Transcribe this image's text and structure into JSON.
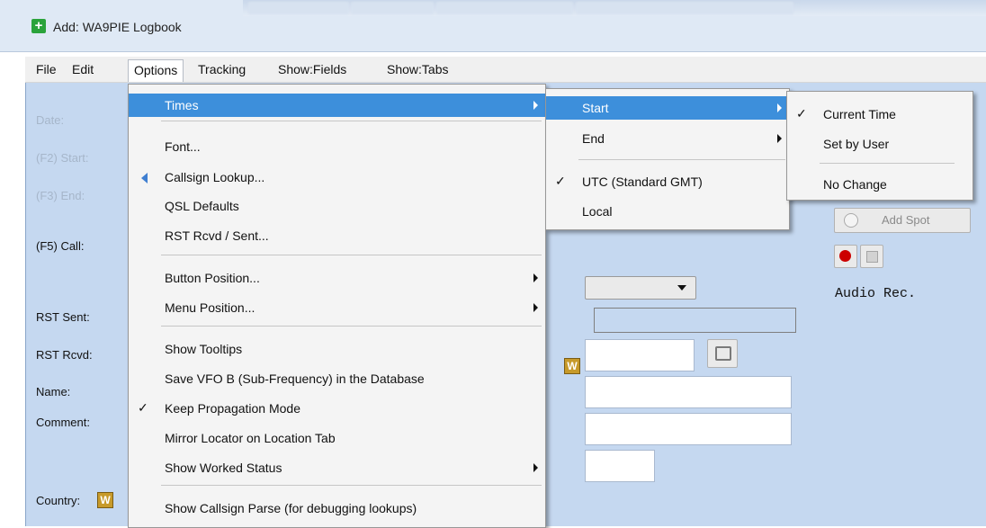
{
  "window": {
    "title": "Add: WA9PIE Logbook"
  },
  "menubar": [
    "File",
    "Edit",
    "Options",
    "Tracking",
    "Show:Fields",
    "Show:Tabs"
  ],
  "form": {
    "date_label": "Date:",
    "start_label": "(F2) Start:",
    "end_label": "(F3) End:",
    "call_label": "(F5) Call:",
    "rst_sent_label": "RST Sent:",
    "rst_rcvd_label": "RST Rcvd:",
    "name_label": "Name:",
    "comment_label": "Comment:",
    "country_label": "Country:",
    "w_badge": "W"
  },
  "right_panel": {
    "add_spot_label": "Add Spot",
    "audio_label": "Audio Rec."
  },
  "options_menu": {
    "items": [
      {
        "label": "Times",
        "submenu": true,
        "highlighted": true
      },
      {
        "label": "Font..."
      },
      {
        "label": "Callsign Lookup..."
      },
      {
        "label": "QSL Defaults"
      },
      {
        "label": "RST Rcvd / Sent..."
      },
      {
        "label": "Button Position...",
        "submenu": true
      },
      {
        "label": "Menu Position...",
        "submenu": true
      },
      {
        "label": "Show Tooltips"
      },
      {
        "label": "Save VFO B (Sub-Frequency) in the Database"
      },
      {
        "label": "Keep Propagation Mode",
        "checked": true
      },
      {
        "label": "Mirror Locator on Location Tab"
      },
      {
        "label": "Show Worked Status",
        "submenu": true
      },
      {
        "label": "Show Callsign Parse (for debugging lookups)"
      }
    ]
  },
  "times_menu": {
    "items": [
      {
        "label": "Start",
        "submenu": true,
        "highlighted": true
      },
      {
        "label": "End",
        "submenu": true
      },
      {
        "label": "UTC (Standard GMT)",
        "checked": true
      },
      {
        "label": "Local"
      }
    ]
  },
  "start_menu": {
    "items": [
      {
        "label": "Current Time",
        "checked": true
      },
      {
        "label": "Set by User"
      },
      {
        "label": "No Change"
      }
    ]
  },
  "colors": {
    "highlight": "#3d8fdb",
    "panel": "#c5d8f0"
  }
}
